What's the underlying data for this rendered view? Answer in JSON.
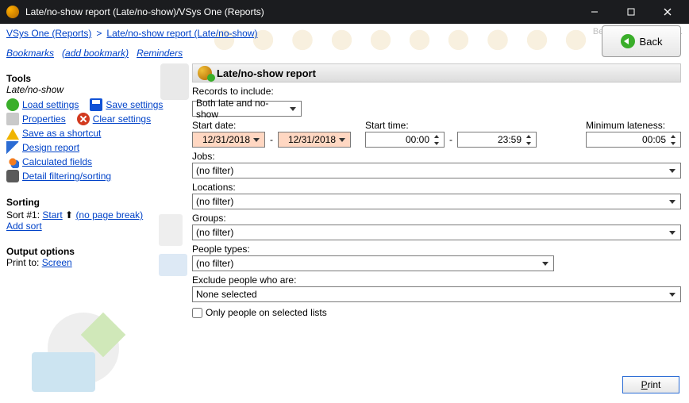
{
  "window": {
    "title": "Late/no-show report (Late/no-show)/VSys One (Reports)"
  },
  "breadcrumb": {
    "root": "VSys One (Reports)",
    "current": "Late/no-show report (Late/no-show)"
  },
  "brand": "Bespoke Software, Inc.",
  "bookmarks": {
    "bookmarks": "Bookmarks",
    "add": "(add bookmark)",
    "reminders": "Reminders"
  },
  "back_label": "Back",
  "tools": {
    "heading": "Tools",
    "subtitle": "Late/no-show",
    "load": "Load settings",
    "save": "Save settings",
    "properties": "Properties",
    "clear": "Clear settings",
    "shortcut": "Save as a shortcut",
    "design": "Design report",
    "calc": "Calculated fields",
    "filter": "Detail filtering/sorting"
  },
  "sorting": {
    "heading": "Sorting",
    "prefix": "Sort #1: ",
    "start": "Start",
    "nobreak": "(no page break)",
    "add": "Add sort"
  },
  "output": {
    "heading": "Output options",
    "prefix": "Print to:  ",
    "target": "Screen"
  },
  "report": {
    "header": "Late/no-show report",
    "records_label": "Records to include:",
    "records_value": "Both late and no-show",
    "start_date_label": "Start date:",
    "start_date_from": "12/31/2018",
    "start_date_to": "12/31/2018",
    "start_time_label": "Start time:",
    "start_time_from": "00:00",
    "start_time_to": "23:59",
    "min_lateness_label": "Minimum lateness:",
    "min_lateness_value": "00:05",
    "jobs_label": "Jobs:",
    "jobs_value": "(no filter)",
    "locations_label": "Locations:",
    "locations_value": "(no filter)",
    "groups_label": "Groups:",
    "groups_value": "(no filter)",
    "people_types_label": "People types:",
    "people_types_value": "(no filter)",
    "exclude_label": "Exclude people who are:",
    "exclude_value": "None selected",
    "only_selected": "Only people on selected lists"
  },
  "print_label": "Print"
}
